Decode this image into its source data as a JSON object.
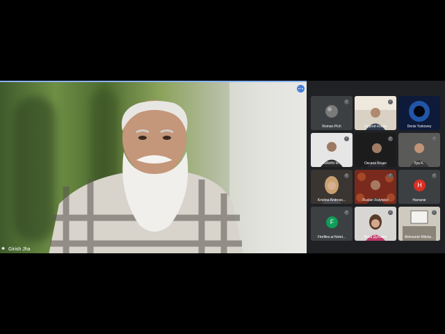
{
  "speaker": {
    "name": "Girish Jha"
  },
  "participants": [
    {
      "name": "Roman Pich"
    },
    {
      "name": "Сергей Косян"
    },
    {
      "name": "Denis Yurkovey"
    },
    {
      "name": "ARMAN M..."
    },
    {
      "name": "Оксана Коцко"
    },
    {
      "name": "Ilya K."
    },
    {
      "name": "Kristina Androso..."
    },
    {
      "name": "Ruslan Ratytskyi"
    },
    {
      "name": "Harranie",
      "initial": "H"
    },
    {
      "name": "Fireflies.ai Notet...",
      "initial": "F"
    },
    {
      "name": "Инна Дубович"
    },
    {
      "name": "Aleksandr Mikola..."
    }
  ],
  "colors": {
    "accent": "#8ab4f8",
    "avatar_h": "#d93025",
    "avatar_f": "#0f9d58",
    "tile_bg": "#3c4043"
  },
  "icons": {
    "mic_off": "mic-off-icon",
    "more": "more-options-icon",
    "pin": "pin-icon"
  }
}
